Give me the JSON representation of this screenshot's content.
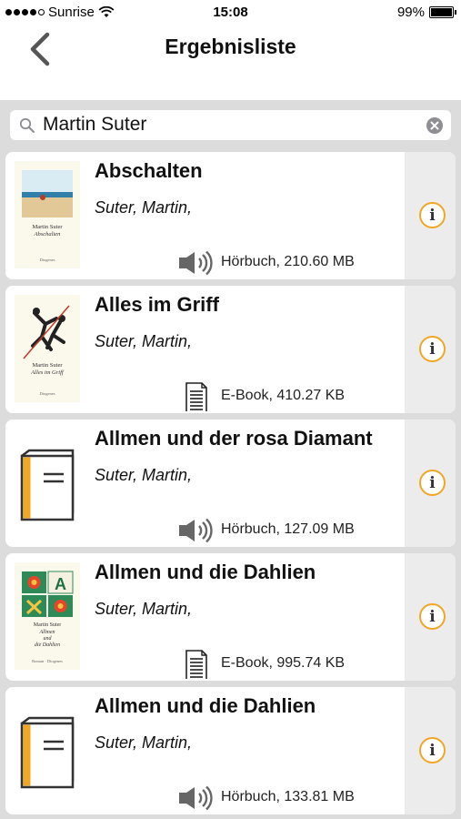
{
  "status": {
    "carrier": "Sunrise",
    "time": "15:08",
    "battery": "99%"
  },
  "nav": {
    "title": "Ergebnisliste"
  },
  "search": {
    "query": "Martin Suter"
  },
  "results": [
    {
      "title": "Abschalten",
      "author": "Suter, Martin,",
      "meta": "Hörbuch, 210.60 MB",
      "media_icon": "speaker-icon",
      "cover": "book-cover-abschalten"
    },
    {
      "title": "Alles im Griff",
      "author": "Suter, Martin,",
      "meta": "E-Book, 410.27 KB",
      "media_icon": "document-icon",
      "cover": "book-cover-alles-im-griff"
    },
    {
      "title": "Allmen und der rosa Diamant",
      "author": "Suter, Martin,",
      "meta": "Hörbuch, 127.09 MB",
      "media_icon": "speaker-icon",
      "cover": "generic-book-icon"
    },
    {
      "title": "Allmen und die Dahlien",
      "author": "Suter, Martin,",
      "meta": "E-Book, 995.74 KB",
      "media_icon": "document-icon",
      "cover": "book-cover-allmen-dahlien"
    },
    {
      "title": "Allmen und die Dahlien",
      "author": "Suter, Martin,",
      "meta": "Hörbuch, 133.81 MB",
      "media_icon": "speaker-icon",
      "cover": "generic-book-icon"
    }
  ],
  "covers": {
    "abschalten": {
      "line1": "Martin Suter",
      "line2": "Abschalten",
      "line3": "Diogenes"
    },
    "alles_im_griff": {
      "line1": "Martin Suter",
      "line2": "Alles im Griff",
      "line3": "Diogenes"
    },
    "allmen_dahlien": {
      "letter": "A",
      "line1": "Martin Suter",
      "line2": "Allmen",
      "line3": "und",
      "line4": "die Dahlien",
      "line5": "Roman · Diogenes"
    }
  },
  "colors": {
    "accent": "#f0a726",
    "book_spine": "#f0a726"
  }
}
